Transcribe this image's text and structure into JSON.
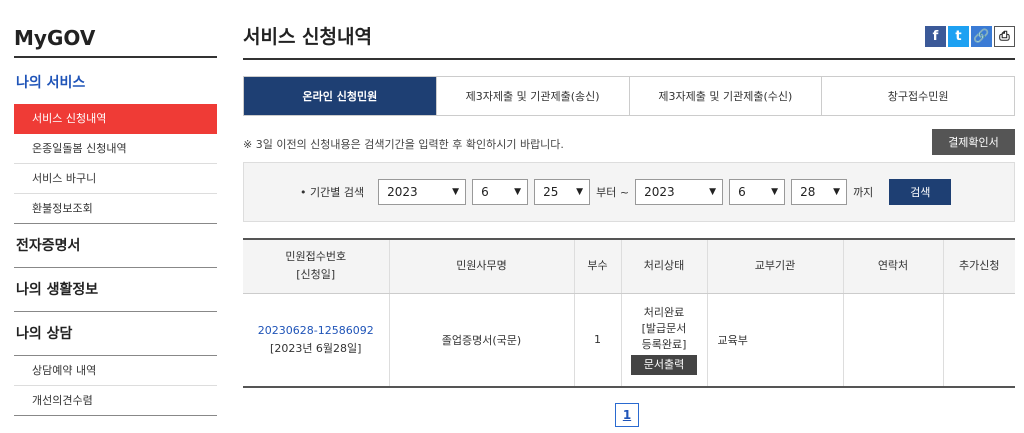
{
  "sidebar": {
    "brand": "MyGOV",
    "section_active": "나의 서비스",
    "items": [
      {
        "label": "서비스 신청내역"
      },
      {
        "label": "온종일돌봄 신청내역"
      },
      {
        "label": "서비스 바구니"
      },
      {
        "label": "환불정보조회"
      }
    ],
    "sections": [
      "전자증명서",
      "나의 생활정보",
      "나의 상담"
    ],
    "consult_items": [
      {
        "label": "상담예약 내역"
      },
      {
        "label": "개선의견수렴"
      }
    ]
  },
  "header": {
    "title": "서비스 신청내역",
    "share": {
      "facebook": "f",
      "twitter": "t",
      "link": "🔗",
      "print": "⎙"
    }
  },
  "tabs": [
    {
      "label": "온라인 신청민원"
    },
    {
      "label": "제3자제출 및 기관제출(송신)"
    },
    {
      "label": "제3자제출 및 기관제출(수신)"
    },
    {
      "label": "창구접수민원"
    }
  ],
  "notice": "※ 3일 이전의 신청내용은 검색기간을 입력한 후 확인하시기 바랍니다.",
  "confirm_button": "결제확인서",
  "search": {
    "label": "• 기간별 검색",
    "from_year": "2023",
    "from_month": "6",
    "from_day": "25",
    "from_text": "부터 ~",
    "to_year": "2023",
    "to_month": "6",
    "to_day": "28",
    "to_text": "까지",
    "button": "검색"
  },
  "table": {
    "headers": [
      "민원접수번호",
      "[신청일]",
      "민원사무명",
      "부수",
      "처리상태",
      "교부기관",
      "연락처",
      "추가신청"
    ],
    "row": {
      "receipt_no": "20230628-12586092",
      "apply_date": "[2023년 6월28일]",
      "name": "졸업증명서(국문)",
      "count": "1",
      "status_1": "처리완료",
      "status_2": "[발급문서",
      "status_3": "등록완료]",
      "print_button": "문서출력",
      "agency": "교육부",
      "contact": "",
      "extra": ""
    }
  },
  "pagination": {
    "current": "1"
  }
}
